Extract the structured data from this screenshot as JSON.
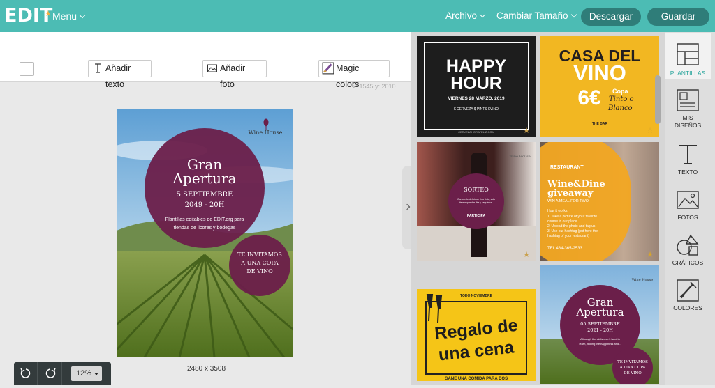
{
  "header": {
    "logo": "EDIT",
    "menu_label": "Menu",
    "file_label": "Archivo",
    "resize_label": "Cambiar Tamaño",
    "download_label": "Descargar",
    "save_label": "Guardar"
  },
  "toolbar": {
    "add_text_label": "Añadir texto",
    "add_photo_label": "Añadir foto",
    "magic_colors_label": "Magic colors",
    "coords": "x: 1545 y: 2010"
  },
  "canvas": {
    "title_line1": "Gran",
    "title_line2": "Apertura",
    "date_line1": "5 SEPTIEMBRE",
    "date_line2": "2049 - 20H",
    "desc_line1": "Plantillas editables de EDIT.org para",
    "desc_line2": "tiendas de licores y bodegas",
    "badge_line1": "TE INVITAMOS",
    "badge_line2": "A UNA COPA",
    "badge_line3": "DE VINO",
    "brand": "Wine House",
    "dimensions": "2480 x 3508"
  },
  "zoom": {
    "value": "12%"
  },
  "templates": {
    "happy_hour": {
      "line1": "HAPPY",
      "line2": "HOUR",
      "date": "VIERNES 28 MARZO, 2019",
      "items": "$ CERVEZA   $ PINTS   $VINO",
      "footer": "CERVEZAHORAFELIZ.COM"
    },
    "casa_vino": {
      "line1": "CASA DEL",
      "line2": "VINO",
      "price": "6€",
      "copa": "Copa",
      "tinto": "Tinto o",
      "blanco": "Blanco",
      "bar": "THE BAR"
    },
    "sorteo": {
      "brand": "Wine House",
      "title": "SORTEO",
      "text": "Gana este delicioso vino tinto, solo tienes que dar like y seguirnos.",
      "cta": "PARTICIPA"
    },
    "wine_dine": {
      "restaurant": "RESTAURANT",
      "line1": "Wine&Dine",
      "line2": "giveaway",
      "subtitle": "WIN A MEAL FOR TWO",
      "how": "How it works:",
      "step1": "1. Take a picture of your favorite",
      "step1b": "course in our place",
      "step2": "2. Upload the photo and tag us",
      "step3": "3. Use our hashtag (put here the",
      "step3b": "hashtag of your restaurant)",
      "phone": "TEL 484-365-2533"
    },
    "regalo": {
      "top": "TODO NOVIEMBRE",
      "line1": "Regalo de",
      "line2": "una cena",
      "bottom": "GANE UNA COMIDA PARA DOS"
    },
    "gran_apertura_2": {
      "brand": "Wine House",
      "title_line1": "Gran",
      "title_line2": "Apertura",
      "date_line1": "05 SEPTIEMBRE",
      "date_line2": "2021 - 20H",
      "desc_line1": "Although the skills aren't hard to",
      "desc_line2": "learn, finding the happiness and...",
      "badge_line1": "TE INVITAMOS",
      "badge_line2": "A UNA COPA",
      "badge_line3": "DE VINO"
    }
  },
  "sidebar": {
    "items": [
      {
        "label": "PLANTILLAS",
        "icon": "templates-icon"
      },
      {
        "label": "MIS",
        "label2": "DISEÑOS",
        "icon": "my-designs-icon"
      },
      {
        "label": "TEXTO",
        "icon": "text-icon"
      },
      {
        "label": "FOTOS",
        "icon": "photos-icon"
      },
      {
        "label": "GRÁFICOS",
        "icon": "graphics-icon"
      },
      {
        "label": "COLORES",
        "icon": "colors-icon"
      }
    ]
  },
  "colors": {
    "brand_teal": "#4cbcb4",
    "button_dark": "#2f7d79",
    "wine_purple": "#6b1f4a",
    "yellow": "#f2b722"
  }
}
